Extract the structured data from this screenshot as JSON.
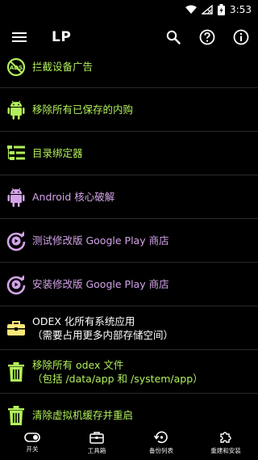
{
  "status": {
    "time": "3:53"
  },
  "toolbar": {
    "title": "LP"
  },
  "items": [
    {
      "label": "拦截设备广告"
    },
    {
      "label": "移除所有已保存的内购"
    },
    {
      "label": "目录绑定器"
    },
    {
      "label": "Android 核心破解"
    },
    {
      "label": "测试修改版 Google Play 商店"
    },
    {
      "label": "安装修改版 Google Play 商店"
    },
    {
      "label": "ODEX 化所有系统应用",
      "sub": "（需要占用更多内部存储空间）"
    },
    {
      "label": "移除所有 odex 文件",
      "sub": "（包括 /data/app 和 /system/app）"
    },
    {
      "label": "清除虚拟机缓存并重启"
    }
  ],
  "tabs": [
    {
      "label": "开关"
    },
    {
      "label": "工具箱"
    },
    {
      "label": "备份列表"
    },
    {
      "label": "重建和安装"
    }
  ],
  "colors": {
    "green": "#b2f05a",
    "purple": "#d3a3e8",
    "background": "#000000"
  }
}
